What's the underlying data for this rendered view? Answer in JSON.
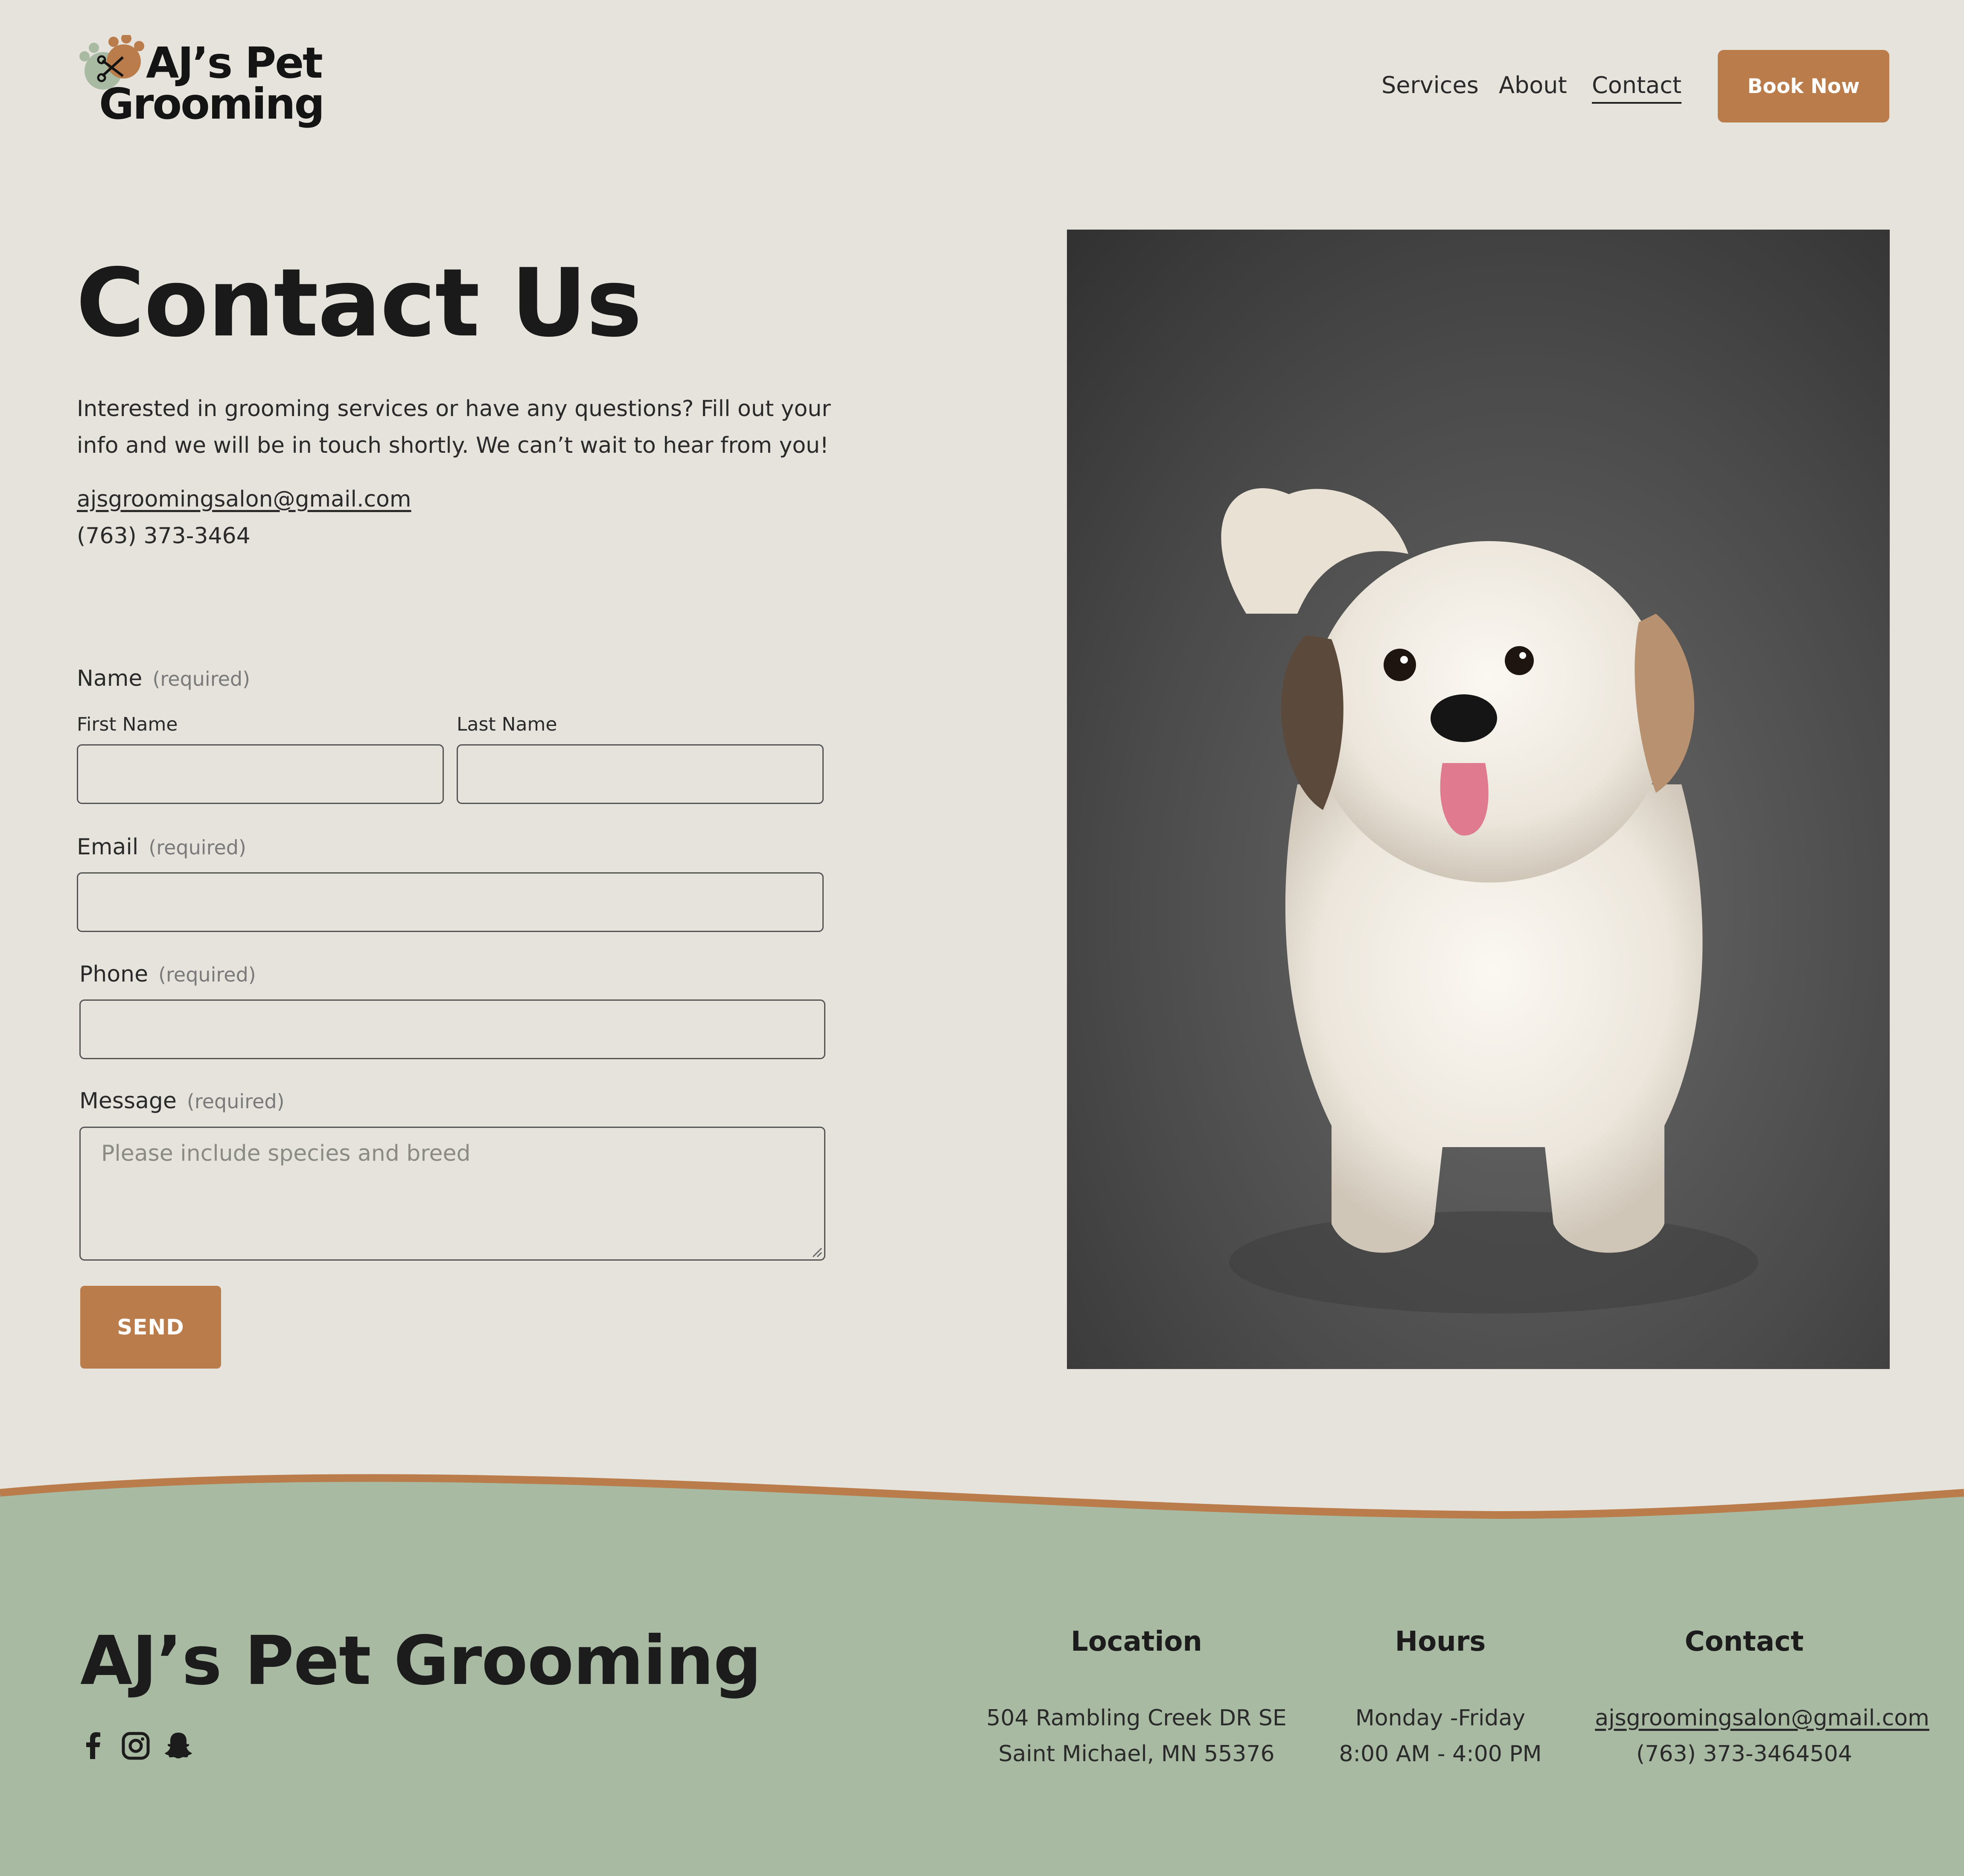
{
  "header": {
    "logo_line1": "AJ’s Pet",
    "logo_line2": "Grooming",
    "nav": [
      "Services",
      "About",
      "Contact"
    ],
    "active_nav": "Contact",
    "book_now": "Book Now"
  },
  "hero": {
    "title": "Contact Us",
    "intro": "Interested in grooming services or have any questions? Fill out your info and we will be in touch shortly. We can’t wait to hear from you!",
    "email": "ajsgroomingsalon@gmail.com",
    "phone": "(763) 373-3464"
  },
  "form": {
    "name_label": "Name",
    "required": "(required)",
    "first_name_label": "First Name",
    "last_name_label": "Last Name",
    "email_label": "Email",
    "phone_label": "Phone",
    "message_label": "Message",
    "message_placeholder": "Please include species and breed",
    "send": "SEND"
  },
  "footer": {
    "title": "AJ’s Pet Grooming",
    "social_icons": [
      "facebook-icon",
      "instagram-icon",
      "snapchat-icon"
    ],
    "location_heading": "Location",
    "location_line1": "504 Rambling Creek DR SE",
    "location_line2": "Saint Michael, MN 55376",
    "hours_heading": "Hours",
    "hours_line1": "Monday -Friday",
    "hours_line2": "8:00 AM - 4:00 PM",
    "contact_heading": "Contact",
    "contact_email": "ajsgroomingsalon@gmail.com",
    "contact_phone": "(763) 373-3464504"
  },
  "colors": {
    "background": "#e6e3dd",
    "accent": "#bb7c4c",
    "footer": "#a8bba2",
    "text": "#1f1f1f"
  }
}
